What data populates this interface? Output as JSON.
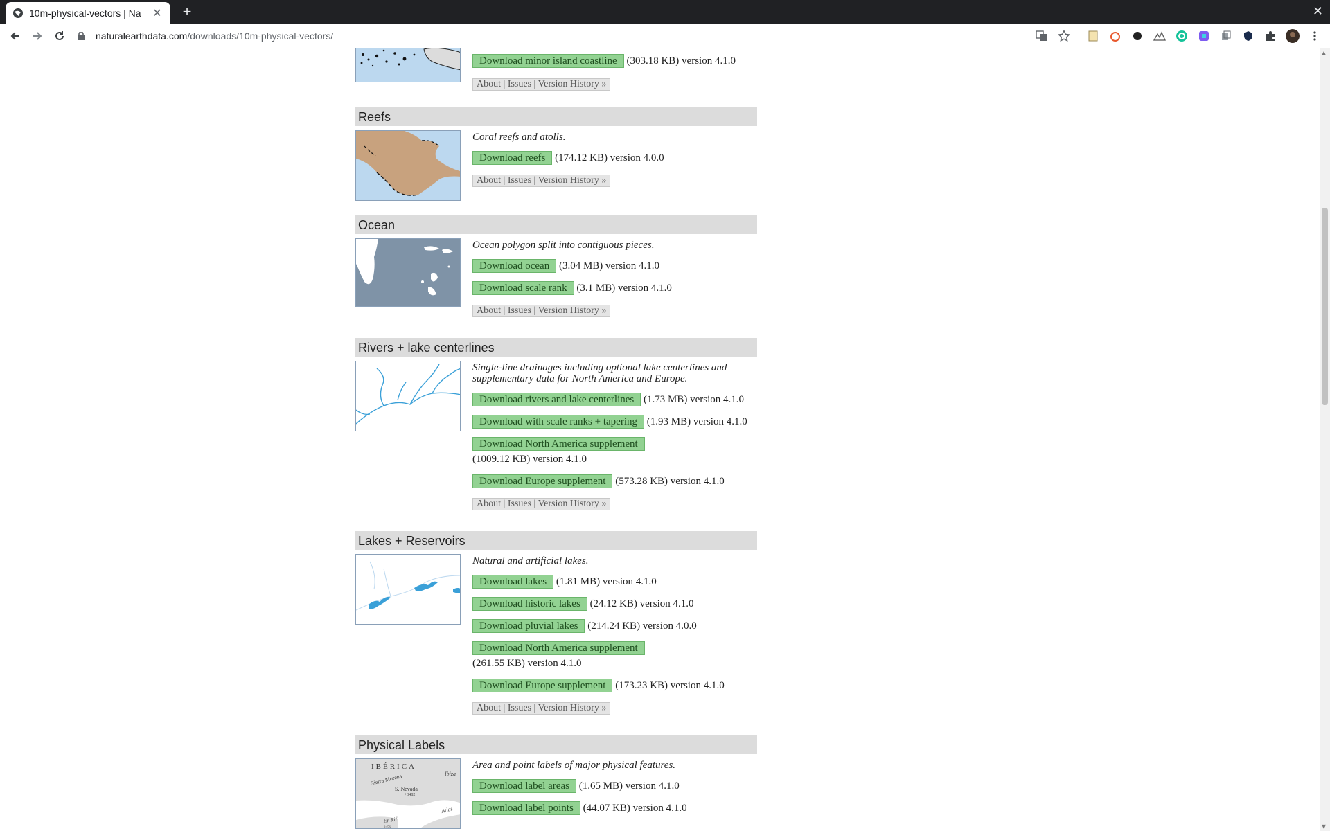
{
  "browser": {
    "tab_title": "10m-physical-vectors | Na",
    "url_host": "naturalearthdata.com",
    "url_path": "/downloads/10m-physical-vectors/"
  },
  "links_labels": {
    "about": "About",
    "sep": " | ",
    "issues": "Issues",
    "history": "Version History »"
  },
  "coastline": {
    "button": "Download minor island coastline",
    "meta": "(303.18 KB) version 4.1.0"
  },
  "reefs": {
    "title": "Reefs",
    "description": "Coral reefs and atolls.",
    "downloads": [
      {
        "label": "Download reefs",
        "meta": "(174.12 KB) version 4.0.0"
      }
    ]
  },
  "ocean": {
    "title": "Ocean",
    "description": "Ocean polygon split into contiguous pieces.",
    "downloads": [
      {
        "label": "Download ocean",
        "meta": "(3.04 MB) version 4.1.0"
      },
      {
        "label": "Download scale rank",
        "meta": "(3.1 MB) version 4.1.0"
      }
    ]
  },
  "rivers": {
    "title": "Rivers + lake centerlines",
    "description": "Single-line drainages including optional lake centerlines and supplementary data for North America and Europe.",
    "downloads": [
      {
        "label": "Download rivers and lake centerlines",
        "meta": "(1.73 MB) version 4.1.0"
      },
      {
        "label": "Download with scale ranks + tapering",
        "meta": "(1.93 MB) version 4.1.0"
      },
      {
        "label": "Download North America supplement",
        "meta": "(1009.12 KB) version 4.1.0"
      },
      {
        "label": "Download Europe supplement",
        "meta": "(573.28 KB) version 4.1.0"
      }
    ]
  },
  "lakes": {
    "title": "Lakes + Reservoirs",
    "description": "Natural and artificial lakes.",
    "downloads": [
      {
        "label": "Download lakes",
        "meta": "(1.81 MB) version 4.1.0"
      },
      {
        "label": "Download historic lakes",
        "meta": "(24.12 KB) version 4.1.0"
      },
      {
        "label": "Download pluvial lakes",
        "meta": "(214.24 KB) version 4.0.0"
      },
      {
        "label": "Download North America supplement",
        "meta": "(261.55 KB) version 4.1.0"
      },
      {
        "label": "Download Europe supplement",
        "meta": "(173.23 KB) version 4.1.0"
      }
    ]
  },
  "labels": {
    "title": "Physical Labels",
    "description": "Area and point labels of major physical features.",
    "downloads": [
      {
        "label": "Download label areas",
        "meta": "(1.65 MB) version 4.1.0"
      },
      {
        "label": "Download label points",
        "meta": "(44.07 KB) version 4.1.0"
      }
    ],
    "map_text": {
      "region": "IBÉRICA",
      "range1": "Sierra Morena",
      "range2": "S. Nevada",
      "peak": "+3482",
      "island": "Ibiza",
      "range3": "Atlas",
      "range4": "Er Rif",
      "peak2": "2456"
    }
  },
  "colors": {
    "button_bg": "#92d292",
    "header_bg": "#dcdcdc",
    "ocean": "#7f93a7",
    "land": "#c8a27e",
    "water": "#bcd8ef",
    "river": "#3aa0d8"
  },
  "icons": [
    "back-icon",
    "forward-icon",
    "reload-icon",
    "lock-icon",
    "translate-icon",
    "star-icon",
    "extensions-icon",
    "menu-icon"
  ]
}
